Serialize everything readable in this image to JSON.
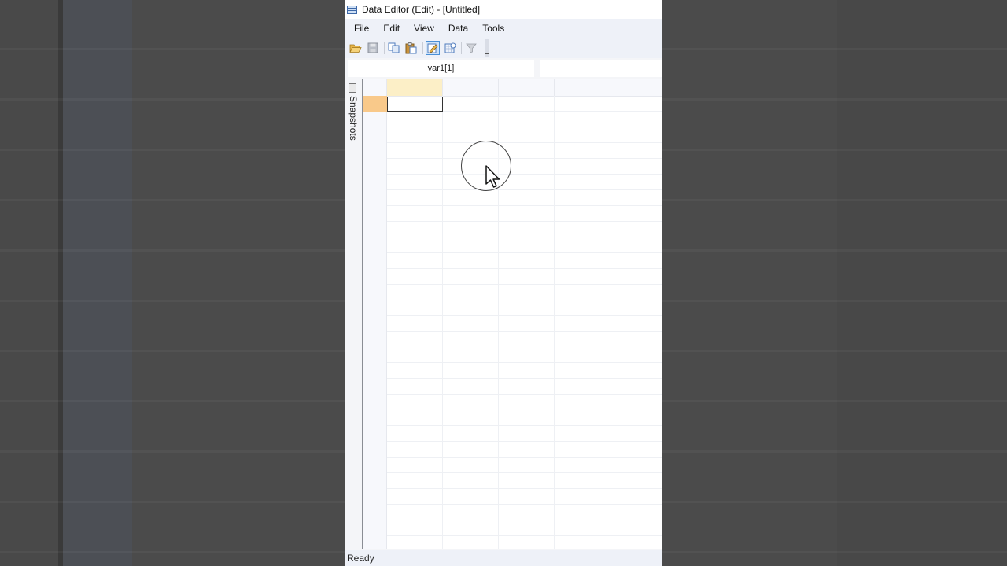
{
  "window": {
    "title": "Data Editor (Edit) - [Untitled]"
  },
  "menu": [
    "File",
    "Edit",
    "View",
    "Data",
    "Tools"
  ],
  "toolbar": {
    "buttons": [
      "open-icon",
      "save-icon",
      "copy-icon",
      "paste-icon",
      "edit-mode-icon",
      "browse-mode-icon",
      "filter-icon"
    ],
    "active_button": "edit-mode-icon"
  },
  "cellbar": {
    "cell_name": "var1[1]",
    "cell_value": ""
  },
  "side_panel": {
    "label": "Snapshots"
  },
  "grid": {
    "selected_row": 1,
    "selected_column": 1,
    "active_cell_value": ""
  },
  "status": {
    "text": "Ready"
  },
  "colors": {
    "active_column_header": "#fcefc7",
    "active_row_header": "#f9c98a",
    "active_toolbar_button": "#cfe3f8"
  }
}
